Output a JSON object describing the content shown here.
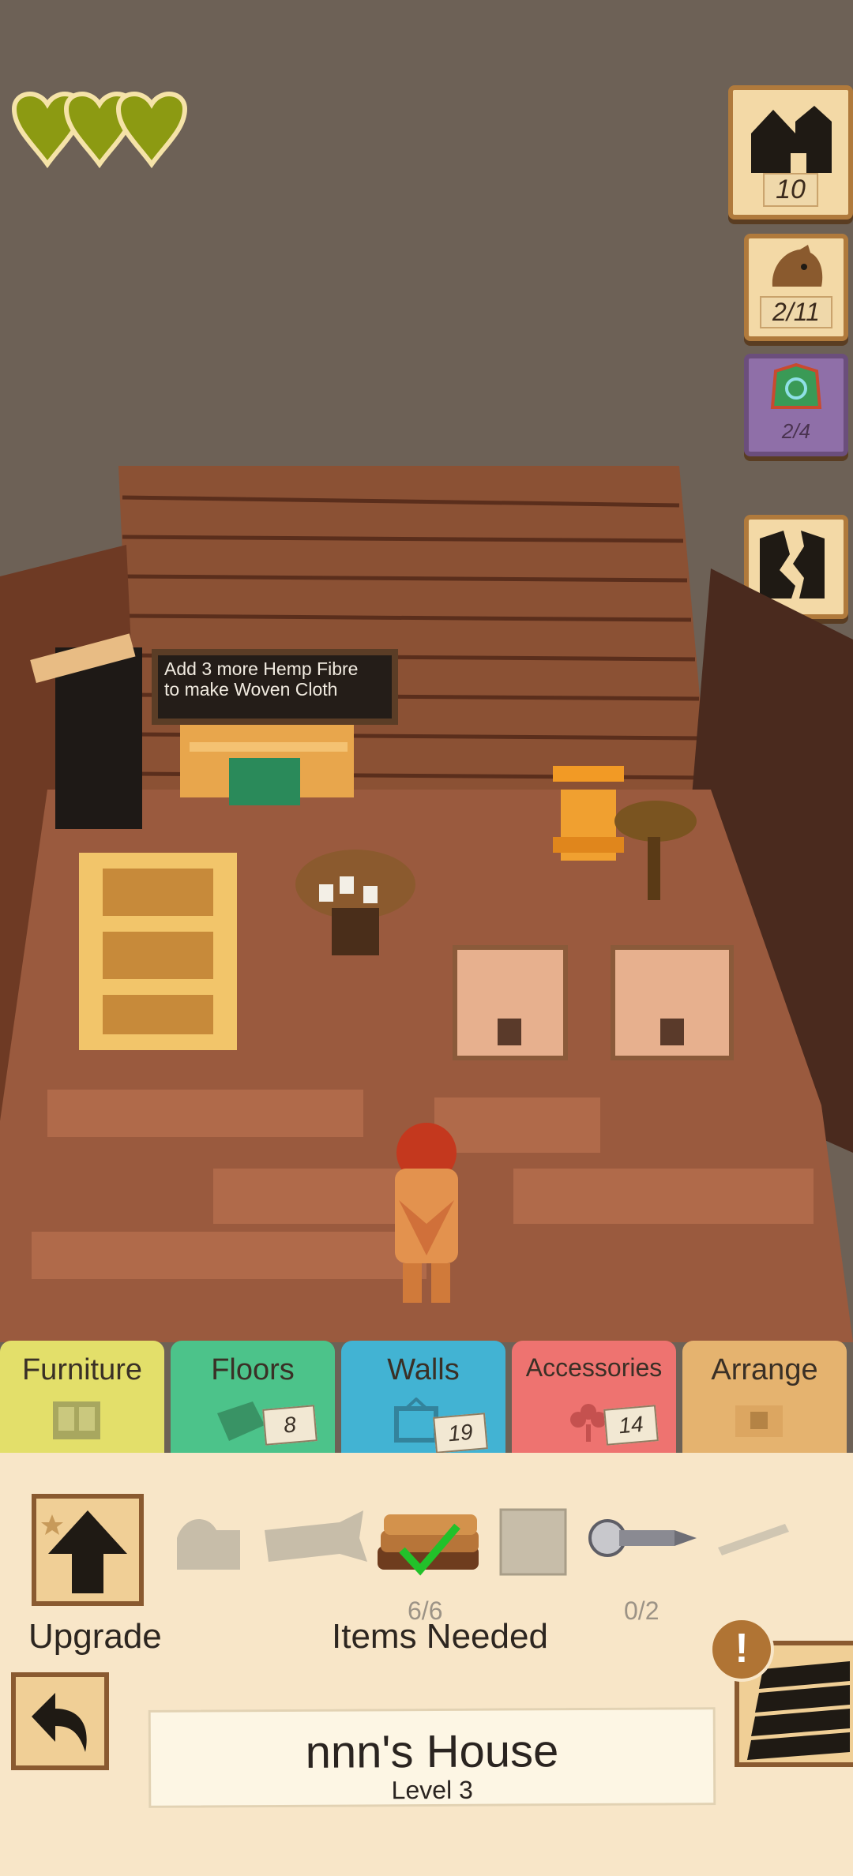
{
  "hud": {
    "hearts": 3,
    "house_count": "10",
    "creature_count": "2/11",
    "rug_count": "2/4"
  },
  "scene": {
    "chalkboard_line1": "Add 3 more Hemp Fibre",
    "chalkboard_line2": "to make Woven Cloth"
  },
  "tabs": [
    {
      "label": "Furniture",
      "color": "#e3df6a",
      "badge": ""
    },
    {
      "label": "Floors",
      "color": "#4cc38a",
      "badge": "8"
    },
    {
      "label": "Walls",
      "color": "#42b3d3",
      "badge": "19"
    },
    {
      "label": "Accessories",
      "color": "#ee7370",
      "badge": "14"
    },
    {
      "label": "Arrange",
      "color": "#e5b36f",
      "badge": ""
    }
  ],
  "panel": {
    "upgrade_label": "Upgrade",
    "items_needed_label": "Items Needed",
    "need_planks": "6/6",
    "need_screws": "0/2",
    "house_name": "nnn's House",
    "house_level": "Level 3",
    "alert_mark": "!"
  }
}
